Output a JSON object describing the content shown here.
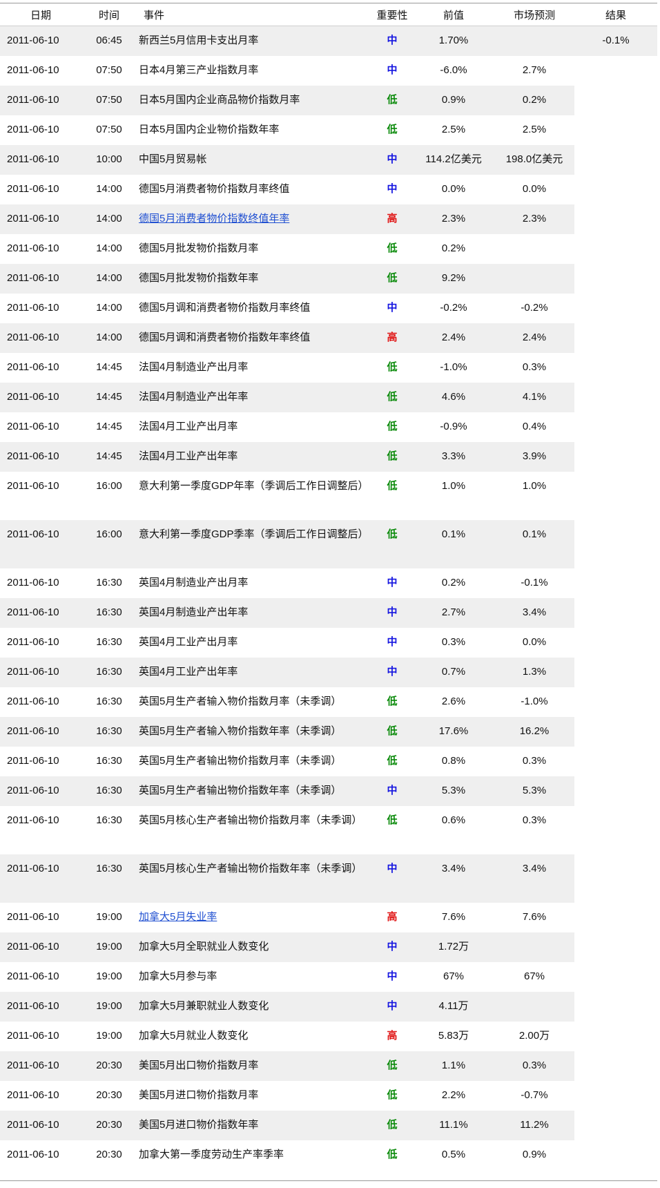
{
  "headers": {
    "date": "日期",
    "time": "时间",
    "event": "事件",
    "importance": "重要性",
    "previous": "前值",
    "forecast": "市场预测",
    "result": "结果"
  },
  "importance_colors": {
    "低": "#0a8a0a",
    "中": "#1414e0",
    "高": "#e01414"
  },
  "rows": [
    {
      "date": "2011-06-10",
      "time": "06:45",
      "event": "新西兰5月信用卡支出月率",
      "importance": "中",
      "previous": "1.70%",
      "forecast": "",
      "result": "-0.1%"
    },
    {
      "date": "2011-06-10",
      "time": "07:50",
      "event": "日本4月第三产业指数月率",
      "importance": "中",
      "previous": "-6.0%",
      "forecast": "2.7%",
      "result": ""
    },
    {
      "date": "2011-06-10",
      "time": "07:50",
      "event": "日本5月国内企业商品物价指数月率",
      "importance": "低",
      "previous": "0.9%",
      "forecast": "0.2%",
      "result": ""
    },
    {
      "date": "2011-06-10",
      "time": "07:50",
      "event": "日本5月国内企业物价指数年率",
      "importance": "低",
      "previous": "2.5%",
      "forecast": "2.5%",
      "result": ""
    },
    {
      "date": "2011-06-10",
      "time": "10:00",
      "event": "中国5月贸易帐",
      "importance": "中",
      "previous": "114.2亿美元",
      "forecast": "198.0亿美元",
      "result": ""
    },
    {
      "date": "2011-06-10",
      "time": "14:00",
      "event": "德国5月消费者物价指数月率终值",
      "importance": "中",
      "previous": "0.0%",
      "forecast": "0.0%",
      "result": ""
    },
    {
      "date": "2011-06-10",
      "time": "14:00",
      "event": "德国5月消费者物价指数终值年率",
      "importance": "高",
      "previous": "2.3%",
      "forecast": "2.3%",
      "result": "",
      "link": true
    },
    {
      "date": "2011-06-10",
      "time": "14:00",
      "event": "德国5月批发物价指数月率",
      "importance": "低",
      "previous": "0.2%",
      "forecast": "",
      "result": ""
    },
    {
      "date": "2011-06-10",
      "time": "14:00",
      "event": "德国5月批发物价指数年率",
      "importance": "低",
      "previous": "9.2%",
      "forecast": "",
      "result": ""
    },
    {
      "date": "2011-06-10",
      "time": "14:00",
      "event": "德国5月调和消费者物价指数月率终值",
      "importance": "中",
      "previous": "-0.2%",
      "forecast": "-0.2%",
      "result": ""
    },
    {
      "date": "2011-06-10",
      "time": "14:00",
      "event": "德国5月调和消费者物价指数年率终值",
      "importance": "高",
      "previous": "2.4%",
      "forecast": "2.4%",
      "result": ""
    },
    {
      "date": "2011-06-10",
      "time": "14:45",
      "event": "法国4月制造业产出月率",
      "importance": "低",
      "previous": "-1.0%",
      "forecast": "0.3%",
      "result": ""
    },
    {
      "date": "2011-06-10",
      "time": "14:45",
      "event": "法国4月制造业产出年率",
      "importance": "低",
      "previous": "4.6%",
      "forecast": "4.1%",
      "result": ""
    },
    {
      "date": "2011-06-10",
      "time": "14:45",
      "event": "法国4月工业产出月率",
      "importance": "低",
      "previous": "-0.9%",
      "forecast": "0.4%",
      "result": ""
    },
    {
      "date": "2011-06-10",
      "time": "14:45",
      "event": "法国4月工业产出年率",
      "importance": "低",
      "previous": "3.3%",
      "forecast": "3.9%",
      "result": ""
    },
    {
      "date": "2011-06-10",
      "time": "16:00",
      "event": "意大利第一季度GDP年率（季调后工作日调整后）",
      "importance": "低",
      "previous": "1.0%",
      "forecast": "1.0%",
      "result": "",
      "tall": true
    },
    {
      "date": "2011-06-10",
      "time": "16:00",
      "event": "意大利第一季度GDP季率（季调后工作日调整后）",
      "importance": "低",
      "previous": "0.1%",
      "forecast": "0.1%",
      "result": "",
      "tall": true
    },
    {
      "date": "2011-06-10",
      "time": "16:30",
      "event": "英国4月制造业产出月率",
      "importance": "中",
      "previous": "0.2%",
      "forecast": "-0.1%",
      "result": ""
    },
    {
      "date": "2011-06-10",
      "time": "16:30",
      "event": "英国4月制造业产出年率",
      "importance": "中",
      "previous": "2.7%",
      "forecast": "3.4%",
      "result": ""
    },
    {
      "date": "2011-06-10",
      "time": "16:30",
      "event": "英国4月工业产出月率",
      "importance": "中",
      "previous": "0.3%",
      "forecast": "0.0%",
      "result": ""
    },
    {
      "date": "2011-06-10",
      "time": "16:30",
      "event": "英国4月工业产出年率",
      "importance": "中",
      "previous": "0.7%",
      "forecast": "1.3%",
      "result": ""
    },
    {
      "date": "2011-06-10",
      "time": "16:30",
      "event": "英国5月生产者输入物价指数月率（未季调）",
      "importance": "低",
      "previous": "2.6%",
      "forecast": "-1.0%",
      "result": ""
    },
    {
      "date": "2011-06-10",
      "time": "16:30",
      "event": "英国5月生产者输入物价指数年率（未季调）",
      "importance": "低",
      "previous": "17.6%",
      "forecast": "16.2%",
      "result": ""
    },
    {
      "date": "2011-06-10",
      "time": "16:30",
      "event": "英国5月生产者输出物价指数月率（未季调）",
      "importance": "低",
      "previous": "0.8%",
      "forecast": "0.3%",
      "result": ""
    },
    {
      "date": "2011-06-10",
      "time": "16:30",
      "event": "英国5月生产者输出物价指数年率（未季调）",
      "importance": "中",
      "previous": "5.3%",
      "forecast": "5.3%",
      "result": ""
    },
    {
      "date": "2011-06-10",
      "time": "16:30",
      "event": "英国5月核心生产者输出物价指数月率（未季调）",
      "importance": "低",
      "previous": "0.6%",
      "forecast": "0.3%",
      "result": "",
      "tall": true
    },
    {
      "date": "2011-06-10",
      "time": "16:30",
      "event": "英国5月核心生产者输出物价指数年率（未季调）",
      "importance": "中",
      "previous": "3.4%",
      "forecast": "3.4%",
      "result": "",
      "tall": true
    },
    {
      "date": "2011-06-10",
      "time": "19:00",
      "event": "加拿大5月失业率",
      "importance": "高",
      "previous": "7.6%",
      "forecast": "7.6%",
      "result": "",
      "link": true
    },
    {
      "date": "2011-06-10",
      "time": "19:00",
      "event": "加拿大5月全职就业人数变化",
      "importance": "中",
      "previous": "1.72万",
      "forecast": "",
      "result": ""
    },
    {
      "date": "2011-06-10",
      "time": "19:00",
      "event": "加拿大5月参与率",
      "importance": "中",
      "previous": "67%",
      "forecast": "67%",
      "result": ""
    },
    {
      "date": "2011-06-10",
      "time": "19:00",
      "event": "加拿大5月兼职就业人数变化",
      "importance": "中",
      "previous": "4.11万",
      "forecast": "",
      "result": ""
    },
    {
      "date": "2011-06-10",
      "time": "19:00",
      "event": "加拿大5月就业人数变化",
      "importance": "高",
      "previous": "5.83万",
      "forecast": "2.00万",
      "result": ""
    },
    {
      "date": "2011-06-10",
      "time": "20:30",
      "event": "美国5月出口物价指数月率",
      "importance": "低",
      "previous": "1.1%",
      "forecast": "0.3%",
      "result": ""
    },
    {
      "date": "2011-06-10",
      "time": "20:30",
      "event": "美国5月进口物价指数月率",
      "importance": "低",
      "previous": "2.2%",
      "forecast": "-0.7%",
      "result": ""
    },
    {
      "date": "2011-06-10",
      "time": "20:30",
      "event": "美国5月进口物价指数年率",
      "importance": "低",
      "previous": "11.1%",
      "forecast": "11.2%",
      "result": ""
    },
    {
      "date": "2011-06-10",
      "time": "20:30",
      "event": "加拿大第一季度劳动生产率季率",
      "importance": "低",
      "previous": "0.5%",
      "forecast": "0.9%",
      "result": ""
    }
  ]
}
